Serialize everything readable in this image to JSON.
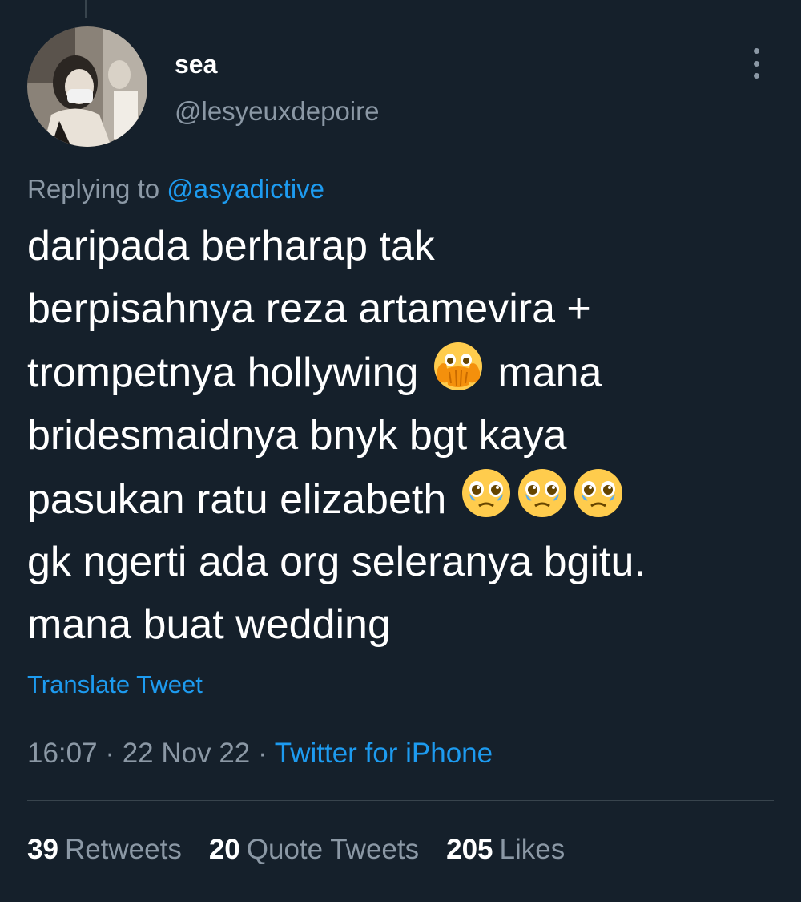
{
  "tweet": {
    "author": {
      "display_name": "sea",
      "handle": "@lesyeuxdepoire"
    },
    "reply": {
      "prefix": "Replying to",
      "to_handle": "@asyadictive"
    },
    "text_lines": [
      "daripada berharap tak",
      "berpisahnya reza artamevira +",
      "trompetnya hollywing",
      "mana",
      "bridesmaidnya bnyk bgt kaya",
      "pasukan ratu elizabeth",
      "gk ngerti ada org seleranya bgitu.",
      "mana buat wedding"
    ],
    "emojis": {
      "line3": "face-with-open-eyes-and-hand-over-mouth-icon",
      "line6": "pleading-face-with-tears-icon"
    },
    "translate_label": "Translate Tweet",
    "time": "16:07",
    "date": "22 Nov 22",
    "separator": "·",
    "source": "Twitter for iPhone"
  },
  "stats": {
    "retweets": {
      "count": "39",
      "label": "Retweets"
    },
    "quotes": {
      "count": "20",
      "label": "Quote Tweets"
    },
    "likes": {
      "count": "205",
      "label": "Likes"
    }
  },
  "colors": {
    "background": "#15202b",
    "text": "#ffffff",
    "secondary": "#8b98a5",
    "accent": "#1d9bf0",
    "divider": "#38444d"
  }
}
